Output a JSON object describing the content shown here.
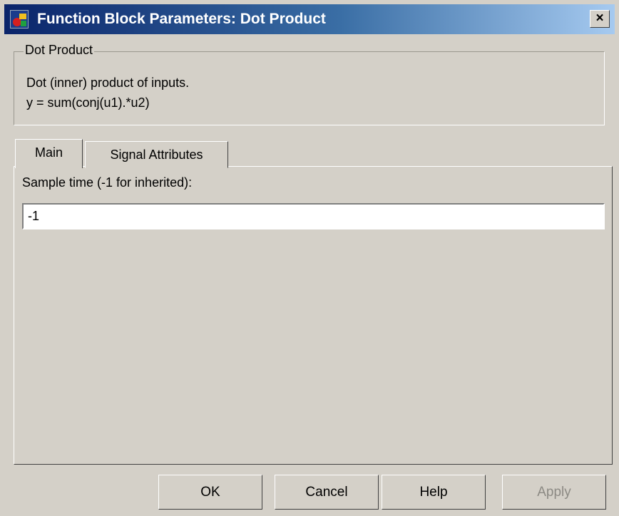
{
  "window": {
    "title": "Function Block Parameters: Dot Product",
    "close_label": "×"
  },
  "block": {
    "group_title": "Dot Product",
    "description_line1": "Dot (inner) product of inputs.",
    "description_line2": "y = sum(conj(u1).*u2)"
  },
  "tabs": [
    {
      "label": "Main",
      "active": true
    },
    {
      "label": "Signal Attributes",
      "active": false
    }
  ],
  "main": {
    "sample_time_label": "Sample time (-1 for inherited):",
    "sample_time_value": "-1"
  },
  "buttons": {
    "ok": "OK",
    "cancel": "Cancel",
    "help": "Help",
    "apply": "Apply",
    "apply_enabled": false
  },
  "colors": {
    "titlebar_start": "#0a246a",
    "titlebar_end": "#a6caf0",
    "window_bg": "#d4d0c8"
  },
  "icons": {
    "app": "simulink-app-icon",
    "close": "close-icon"
  }
}
